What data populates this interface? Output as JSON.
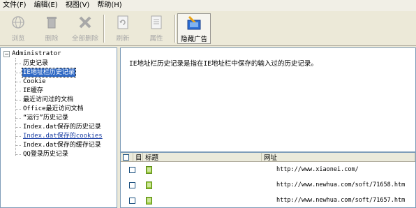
{
  "menubar": {
    "items": [
      {
        "label": "文件(F)"
      },
      {
        "label": "编辑(E)"
      },
      {
        "label": "视图(V)"
      },
      {
        "label": "帮助(H)"
      }
    ]
  },
  "toolbar": {
    "buttons": [
      {
        "label": "浏览",
        "icon": "browse-icon",
        "enabled": false
      },
      {
        "label": "删除",
        "icon": "delete-icon",
        "enabled": false
      },
      {
        "label": "全部删除",
        "icon": "delete-all-icon",
        "enabled": false
      },
      {
        "label": "刷新",
        "icon": "refresh-icon",
        "enabled": false
      },
      {
        "label": "属性",
        "icon": "properties-icon",
        "enabled": false
      },
      {
        "label": "隐藏广告",
        "icon": "hide-ads-icon",
        "enabled": true
      }
    ]
  },
  "tree": {
    "root": "Administrator",
    "expander": "−",
    "items": [
      {
        "label": "历史记录"
      },
      {
        "label": "IE地址栏历史记录",
        "selected": true
      },
      {
        "label": "Cookie"
      },
      {
        "label": "IE缓存"
      },
      {
        "label": "最近访问过的文档"
      },
      {
        "label": "Office最近访问文档"
      },
      {
        "label": "“运行”历史记录"
      },
      {
        "label": "Index.dat保存的历史记录"
      },
      {
        "label": "Index.dat保存的cookies",
        "link": true
      },
      {
        "label": "Index.dat保存的缓存记录"
      },
      {
        "label": "QQ登录历史记录"
      }
    ]
  },
  "description": {
    "text": "IE地址栏历史记录是指在IE地址栏中保存的输入过的历史记录。"
  },
  "list": {
    "columns": {
      "check": "",
      "icon": "",
      "title": "标题",
      "url": "网址"
    },
    "rows": [
      {
        "title": "",
        "url": "http://www.xiaonei.com/"
      },
      {
        "title": "",
        "url": "http://www.newhua.com/soft/71658.htm"
      },
      {
        "title": "",
        "url": "http://www.newhua.com/soft/71657.htm"
      }
    ]
  },
  "colors": {
    "selection": "#316ac5",
    "window_bg": "#ece9d8",
    "border": "#7f9db9",
    "file_icon": "#8bc34a"
  }
}
